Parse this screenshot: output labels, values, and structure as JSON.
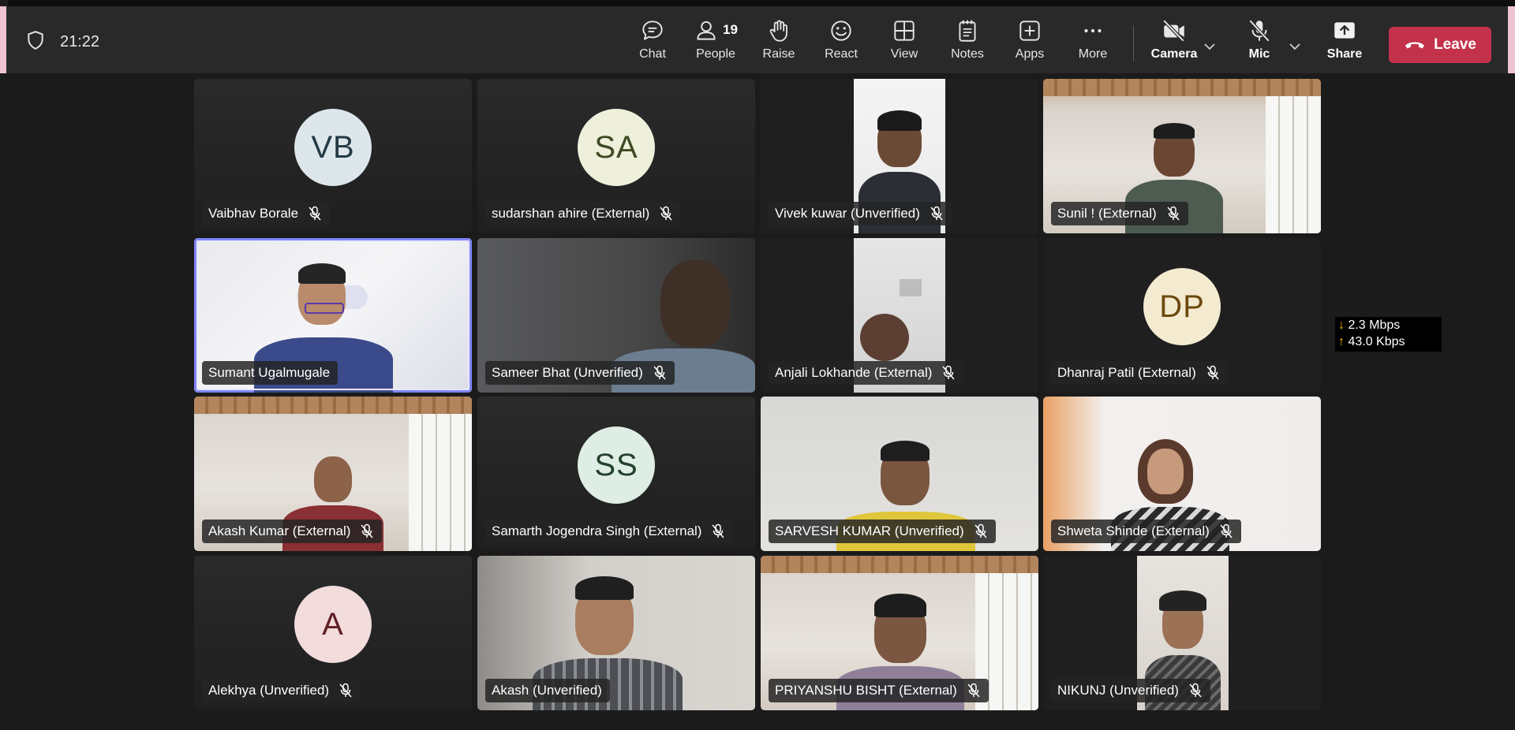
{
  "meeting": {
    "time": "21:22"
  },
  "toolbar": {
    "chat": "Chat",
    "people": "People",
    "people_count": "19",
    "raise": "Raise",
    "react": "React",
    "view": "View",
    "notes": "Notes",
    "apps": "Apps",
    "more": "More",
    "camera": "Camera",
    "mic": "Mic",
    "share": "Share",
    "leave": "Leave"
  },
  "participants": [
    {
      "name": "Vaibhav Borale",
      "initials": "VB",
      "muted": true
    },
    {
      "name": "sudarshan ahire (External)",
      "initials": "SA",
      "muted": true
    },
    {
      "name": "Vivek kuwar (Unverified)",
      "muted": true
    },
    {
      "name": "Sunil ! (External)",
      "muted": true
    },
    {
      "name": "Sumant Ugalmugale",
      "muted": false
    },
    {
      "name": "Sameer Bhat (Unverified)",
      "muted": true
    },
    {
      "name": "Anjali Lokhande (External)",
      "muted": true
    },
    {
      "name": "Dhanraj Patil (External)",
      "initials": "DP",
      "muted": true
    },
    {
      "name": "Akash Kumar (External)",
      "muted": true
    },
    {
      "name": "Samarth Jogendra Singh (External)",
      "initials": "SS",
      "muted": true
    },
    {
      "name": "SARVESH KUMAR (Unverified)",
      "muted": true
    },
    {
      "name": "Shweta Shinde (External)",
      "muted": true
    },
    {
      "name": "Alekhya (Unverified)",
      "initials": "A",
      "muted": true
    },
    {
      "name": "Akash (Unverified)",
      "muted": false
    },
    {
      "name": "PRIYANSHU BISHT (External)",
      "muted": true
    },
    {
      "name": "NIKUNJ (Unverified)",
      "muted": true
    }
  ],
  "network_stats": {
    "down": "2.3 Mbps",
    "up": "43.0 Kbps"
  },
  "colors": {
    "leave": "#c4314b",
    "active_speaker": "#7f85f5",
    "avatar_vb": "#dde6ea",
    "avatar_sa": "#eef0dc",
    "avatar_dp": "#f3ead0",
    "avatar_ss": "#dfeee4",
    "avatar_a": "#f2dcdc"
  },
  "icons": {
    "shield": "shield-icon",
    "chat": "chat-icon",
    "people": "people-icon",
    "raise": "hand-icon",
    "react": "smiley-icon",
    "view": "grid-icon",
    "notes": "notes-icon",
    "apps": "apps-plus-icon",
    "more": "more-icon",
    "camera": "camera-off-icon",
    "mic": "mic-off-icon",
    "share": "share-icon",
    "leave": "phone-hangup-icon"
  }
}
